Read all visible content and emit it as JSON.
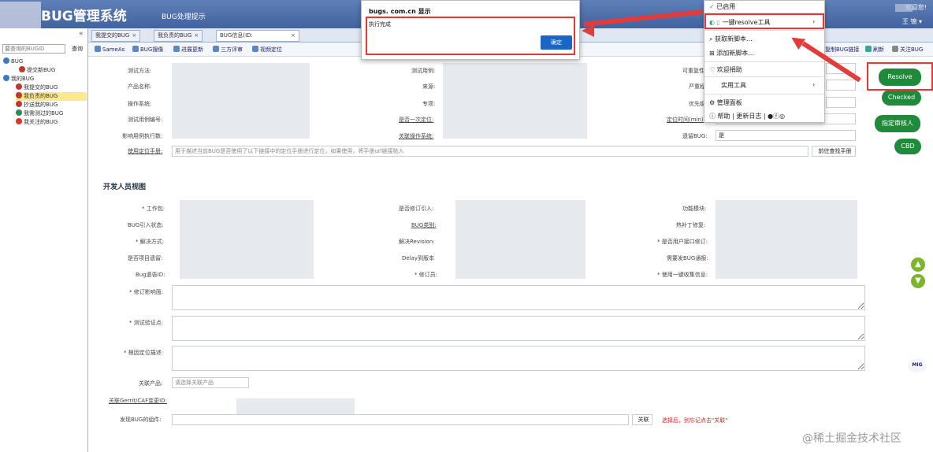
{
  "header": {
    "title": "BUG管理系统",
    "page_heading": "BUG处理提示",
    "welcome": "欢迎您!",
    "user": "王 锦 ▾"
  },
  "sidebar": {
    "collapse": "«",
    "search_placeholder": "要查询的BUGID",
    "search_button": "查询",
    "tree": [
      {
        "label": "BUG",
        "color": "#3a78c8"
      },
      {
        "label": "提交新BUG",
        "color": "#c0392b"
      },
      {
        "label": "我的BUG",
        "color": "#3a78c8"
      },
      {
        "label": "我提交的BUG",
        "color": "#c0392b"
      },
      {
        "label": "我负责的BUG",
        "color": "#c0392b"
      },
      {
        "label": "抄送我的BUG",
        "color": "#c0392b"
      },
      {
        "label": "我需测过的BUG",
        "color": "#2e8b57"
      },
      {
        "label": "我关注的BUG",
        "color": "#d33"
      }
    ]
  },
  "tabs": [
    "我提交的BUG",
    "我负责的BUG",
    "BUG信息(ID:"
  ],
  "toolbar": [
    "SameAs",
    "BUG搜像",
    "进展更新",
    "三方评审",
    "视频定位"
  ],
  "toolbar_right": [
    "复制BUG链接",
    "刷新",
    "关注BUG"
  ],
  "form_top": {
    "labels_col1": [
      "测试方法:",
      "产品名称:",
      "操作系统:",
      "测试用例编号:",
      "影响用例执行数:"
    ],
    "labels_col2": [
      "测试用例:",
      "来源:",
      "专项:",
      "是否一次定位:",
      "关联操作系统:"
    ],
    "labels_col3": [
      "可重复性:",
      "严重程度:",
      "优先级:",
      "定位时间(min):",
      "遗留BUG:"
    ],
    "legacy_value": "是",
    "manual_label": "使用定位手册:",
    "manual_placeholder": "用于描述当前BUG是否使用了以下链接中的定位手册进行定位，如果使用，将手册url链接贴入",
    "manual_button": "前往查找手册"
  },
  "section_dev": "开发人员视图",
  "dev_form": {
    "col1": [
      "* 工作包:",
      "BUG引入状态:",
      "* 解决方式:",
      "是否项目遗留:",
      "Bug遗告ID:"
    ],
    "col2": [
      "是否修订引入:",
      "BUG类别:",
      "解决Revision:",
      "Delay到版本",
      "* 修订员:"
    ],
    "col3": [
      "功能模块:",
      "热补丁修复:",
      "* 是否用户接口修订:",
      "需要发BUG通报:",
      "* 使用一键收集信息:"
    ],
    "areas": [
      "* 修订影响面:",
      "* 测试验证点:",
      "* 根因定位描述:"
    ],
    "related_product_label": "关联产品:",
    "related_product_value": "请选择关联产品",
    "gerrit_label": "关联Gerrit/CAF变更ID:",
    "component_label": "发现BUG的组件:",
    "link_button": "关联",
    "hint": "选择后，别忘记点击\"关联\""
  },
  "side_buttons": [
    "Resolve",
    "Checked",
    "指定审核人",
    "CBD"
  ],
  "alert": {
    "title": "bugs.        com.cn 显示",
    "message": "执行完成",
    "ok": "确定"
  },
  "menu": {
    "items": [
      "已启用",
      "一键resolve工具",
      "获取新脚本...",
      "添加新脚本...",
      "欢迎捐助",
      "实用工具",
      "管理面板",
      "帮助 | 更新日志 |"
    ]
  },
  "watermark": "@稀土掘金技术社区",
  "mig": "MIG",
  "colors": {
    "header": "#4a6aa8",
    "accent_green": "#1e8a3a",
    "highlight_red": "#e33"
  }
}
